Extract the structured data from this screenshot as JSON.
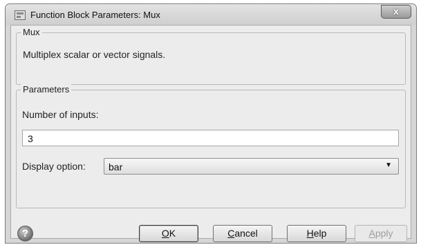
{
  "window": {
    "title": "Function Block Parameters: Mux",
    "close_label": "x"
  },
  "mux_group": {
    "heading": "Mux",
    "description": "Multiplex scalar or vector signals."
  },
  "parameters_group": {
    "heading": "Parameters",
    "num_inputs_label": "Number of inputs:",
    "num_inputs_value": "3",
    "display_option_label": "Display option:",
    "display_option_value": "bar"
  },
  "buttons": {
    "ok": {
      "mnemonic": "O",
      "rest": "K"
    },
    "cancel": {
      "mnemonic": "C",
      "rest": "ancel"
    },
    "help": {
      "mnemonic": "H",
      "rest": "elp"
    },
    "apply": {
      "mnemonic": "A",
      "rest": "pply"
    }
  },
  "help_icon_glyph": "?",
  "icons": {
    "app": "block-parameters-icon",
    "help": "help-icon",
    "close": "close-icon",
    "dropdown": "chevron-down-icon"
  }
}
